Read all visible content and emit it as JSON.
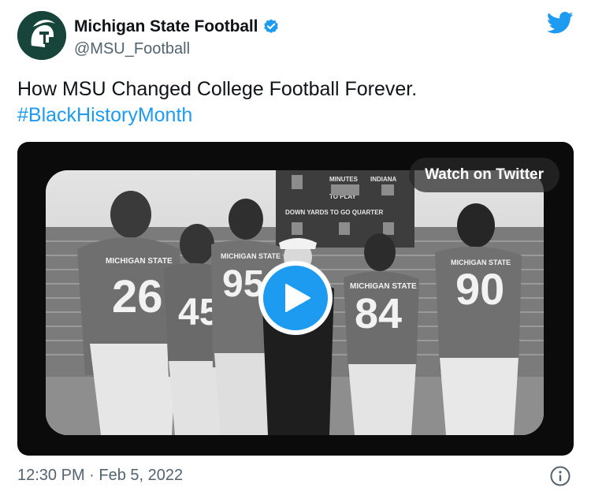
{
  "tweet": {
    "author": {
      "display_name": "Michigan State Football",
      "handle": "@MSU_Football",
      "verified": true,
      "avatar_icon": "spartan-helmet-icon",
      "avatar_color": "#18453b"
    },
    "text": "How MSU Changed College Football Forever.",
    "hashtag": "#BlackHistoryMonth",
    "timestamp": "12:30 PM · Feb 5, 2022",
    "brand_icon": "twitter-bird-icon",
    "brand_color": "#1d9bf0"
  },
  "media": {
    "watch_label": "Watch on Twitter",
    "play_icon": "play-icon",
    "photo": {
      "scoreboard": {
        "minutes_label": "MINUTES",
        "to_play_label": "TO PLAY",
        "team_label": "INDIANA",
        "down_label": "DOWN  YARDS TO GO  QUARTER"
      },
      "jerseys": [
        {
          "number": "26",
          "team": "MICHIGAN STATE"
        },
        {
          "number": "45",
          "team": ""
        },
        {
          "number": "95",
          "team": "MICHIGAN STATE"
        },
        {
          "number": "84",
          "team": "MICHIGAN STATE"
        },
        {
          "number": "90",
          "team": "MICHIGAN STATE"
        }
      ]
    }
  },
  "footer": {
    "info_icon": "info-icon"
  }
}
